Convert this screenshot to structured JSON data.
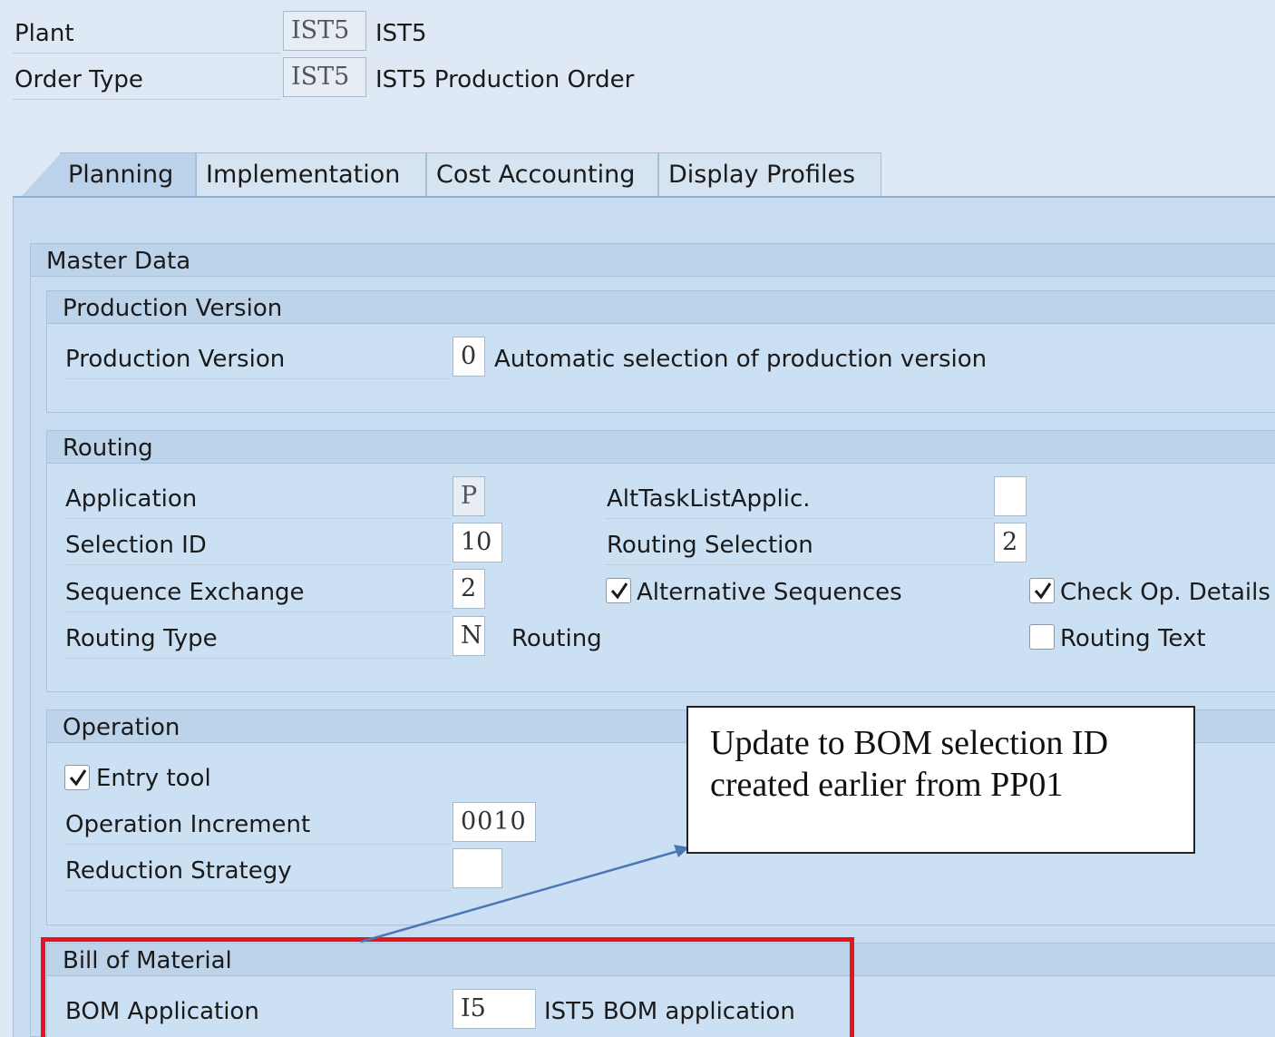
{
  "header": {
    "plant": {
      "label": "Plant",
      "value": "IST5",
      "desc": "IST5"
    },
    "order_type": {
      "label": "Order Type",
      "value": "IST5",
      "desc": "IST5 Production Order"
    }
  },
  "tabs": [
    {
      "label": "Planning",
      "active": true
    },
    {
      "label": "Implementation",
      "active": false
    },
    {
      "label": "Cost Accounting",
      "active": false
    },
    {
      "label": "Display Profiles",
      "active": false
    }
  ],
  "master_data": {
    "title": "Master Data",
    "production_version": {
      "title": "Production Version",
      "label": "Production Version",
      "value": "0",
      "desc": "Automatic selection of production version"
    },
    "routing": {
      "title": "Routing",
      "application": {
        "label": "Application",
        "value": "P"
      },
      "selection_id": {
        "label": "Selection ID",
        "value": "10"
      },
      "sequence_exchange": {
        "label": "Sequence Exchange",
        "value": "2"
      },
      "routing_type": {
        "label": "Routing Type",
        "value": "N",
        "desc": "Routing"
      },
      "alt_task_list": {
        "label": "AltTaskListApplic.",
        "value": ""
      },
      "routing_selection": {
        "label": "Routing Selection",
        "value": "2"
      },
      "alternative_sequences": {
        "label": "Alternative Sequences",
        "checked": true
      },
      "check_op_details": {
        "label": "Check Op. Details",
        "checked": true
      },
      "routing_text": {
        "label": "Routing Text",
        "checked": false
      }
    },
    "operation": {
      "title": "Operation",
      "entry_tool": {
        "label": "Entry tool",
        "checked": true
      },
      "operation_increment": {
        "label": "Operation Increment",
        "value": "0010"
      },
      "reduction_strategy": {
        "label": "Reduction Strategy",
        "value": ""
      }
    },
    "bill_of_material": {
      "title": "Bill of Material",
      "bom_application": {
        "label": "BOM Application",
        "value": "I5",
        "desc": "IST5 BOM application"
      }
    }
  },
  "annotation": {
    "line1": "Update to BOM selection ID",
    "line2": "created earlier from PP01",
    "highlight_color": "#e8131b",
    "arrow_color": "#4a78b5"
  }
}
